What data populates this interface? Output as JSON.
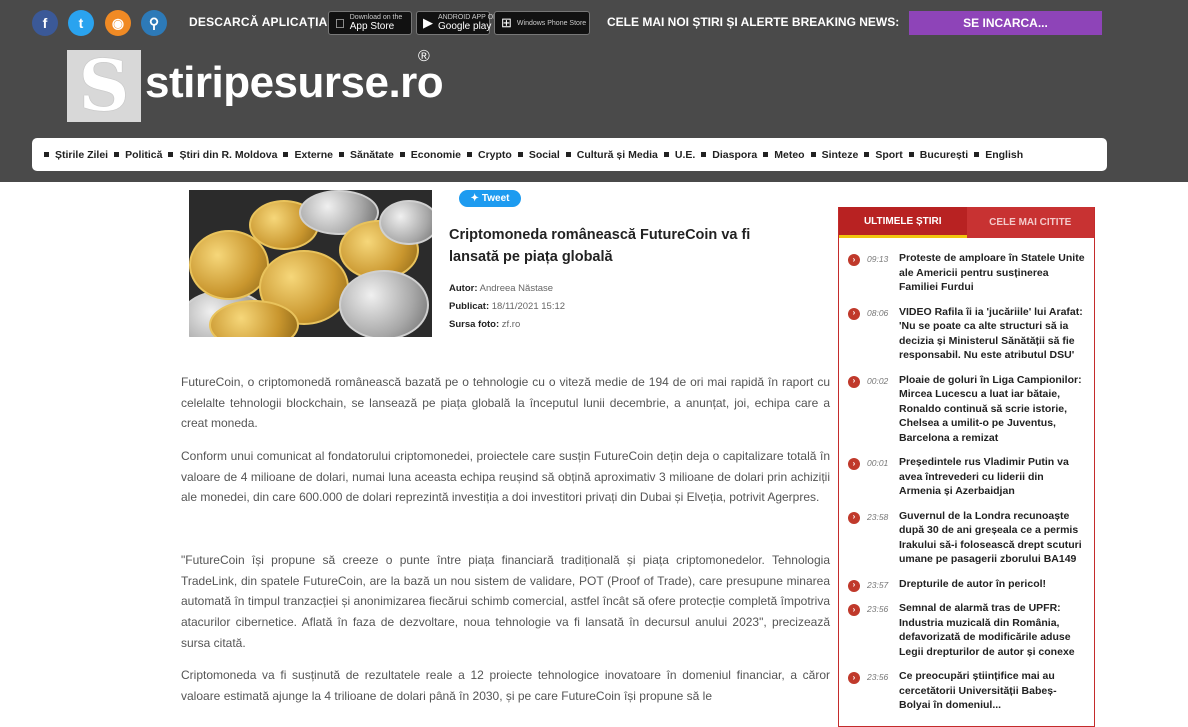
{
  "topbar": {
    "social": [
      {
        "name": "facebook-icon",
        "glyph": "f"
      },
      {
        "name": "twitter-icon",
        "glyph": "t"
      },
      {
        "name": "rss-icon",
        "glyph": "◉"
      },
      {
        "name": "search-icon",
        "glyph": "⚲"
      }
    ],
    "app_label": "DESCARCĂ APLICAȚIA:",
    "stores": {
      "appstore": {
        "small": "Download on the",
        "big": "App Store"
      },
      "gplay": {
        "small": "ANDROID APP ON",
        "big": "Google play"
      },
      "winphone": {
        "big": "Windows Phone Store"
      }
    },
    "breaking_label": "CELE MAI NOI ȘTIRI ȘI ALERTE BREAKING NEWS:",
    "breaking_value": "SE INCARCA..."
  },
  "logo": {
    "mark": "S",
    "text": "stiripesurse.ro",
    "registered": "®"
  },
  "nav": [
    "Știrile Zilei",
    "Politică",
    "Știri din R. Moldova",
    "Externe",
    "Sănătate",
    "Economie",
    "Crypto",
    "Social",
    "Cultură și Media",
    "U.E.",
    "Diaspora",
    "Meteo",
    "Sinteze",
    "Sport",
    "București",
    "English"
  ],
  "article": {
    "tweet_label": "Tweet",
    "title": "Criptomoneda românească FutureCoin va fi lansată pe piața globală",
    "author_label": "Autor:",
    "author": "Andreea Năstase",
    "published_label": "Publicat:",
    "published": "18/11/2021 15:12",
    "source_label": "Sursa foto:",
    "source": "zf.ro",
    "paragraphs": [
      "FutureCoin, o criptomonedă românească bazată pe o tehnologie cu o viteză medie de 194 de ori mai rapidă în raport cu celelalte tehnologii blockchain, se lansează pe piața globală la începutul lunii decembrie, a anunțat, joi, echipa care a creat moneda.",
      "Conform unui comunicat al fondatorului criptomonedei, proiectele care susțin FutureCoin dețin deja o capitalizare totală în valoare de 4 milioane de dolari, numai luna aceasta echipa reușind să obțină aproximativ 3 milioane de dolari prin achiziții ale monedei, din care 600.000 de dolari reprezintă investiția a doi investitori privați din Dubai și Elveția, potrivit Agerpres.",
      "\"FutureCoin își propune să creeze o punte între piața financiară tradițională și piața criptomonedelor. Tehnologia TradeLink, din spatele FutureCoin, are la bază un nou sistem de validare, POT (Proof of Trade), care presupune minarea automată în timpul tranzacției și anonimizarea fiecărui schimb comercial, astfel încât să ofere protecție completă împotriva atacurilor cibernetice. Aflată în faza de dezvoltare, noua tehnologie va fi lansată în decursul anului 2023\", precizează sursa citată.",
      "Criptomoneda va fi susținută de rezultatele reale a 12 proiecte tehnologice inovatoare în domeniul financiar, a căror valoare estimată ajunge la 4 trilioane de dolari până în 2030, și pe care FutureCoin își propune să le"
    ]
  },
  "sidebar": {
    "tab_active": "ULTIMELE ȘTIRI",
    "tab_inactive": "CELE MAI CITITE",
    "items": [
      {
        "time": "09:13",
        "title": "Proteste de amploare în Statele Unite ale Americii pentru susținerea Familiei Furdui"
      },
      {
        "time": "08:06",
        "title": "VIDEO Rafila îi ia 'jucăriile' lui Arafat: 'Nu se poate ca alte structuri să ia decizia și Ministerul Sănătății să fie responsabil. Nu este atributul DSU'"
      },
      {
        "time": "00:02",
        "title": "Ploaie de goluri în Liga Campionilor: Mircea Lucescu a luat iar bătaie, Ronaldo continuă să scrie istorie, Chelsea a umilit-o pe Juventus, Barcelona a remizat"
      },
      {
        "time": "00:01",
        "title": "Președintele rus Vladimir Putin va avea întrevederi cu liderii din Armenia și Azerbaidjan"
      },
      {
        "time": "23:58",
        "title": "Guvernul de la Londra recunoaște după 30 de ani greșeala ce a permis Irakului să-i folosească drept scuturi umane pe pasagerii zborului BA149"
      },
      {
        "time": "23:57",
        "title": "Drepturile de autor în pericol!"
      },
      {
        "time": "23:56",
        "title": "Semnal de alarmă tras de UPFR: Industria muzicală din România, defavorizată de modificările aduse Legii drepturilor de autor și conexe"
      },
      {
        "time": "23:56",
        "title": "Ce preocupări științifice mai au cercetătorii Universității Babeș-Bolyai în domeniul..."
      }
    ]
  }
}
